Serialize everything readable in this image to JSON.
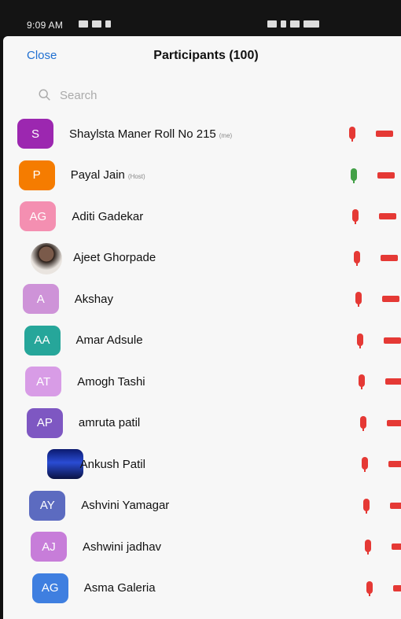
{
  "status_bar": {
    "time": "9:09 AM"
  },
  "header": {
    "close_label": "Close",
    "title": "Participants (100)"
  },
  "search": {
    "placeholder": "Search"
  },
  "colors": {
    "mic_muted": "#e53935",
    "mic_active": "#43a047",
    "video_off": "#e53935",
    "link": "#1f6fd1"
  },
  "participants": [
    {
      "initials": "S",
      "name": "Shaylsta Maner Roll No 215",
      "tag": "(me)",
      "avatar_color": "#9c27b0",
      "mic": "muted"
    },
    {
      "initials": "P",
      "name": "Payal Jain",
      "tag": "(Host)",
      "avatar_color": "#f57c00",
      "mic": "active"
    },
    {
      "initials": "AG",
      "name": "Aditi Gadekar",
      "tag": "",
      "avatar_color": "#f48fb1",
      "mic": "muted"
    },
    {
      "initials": "",
      "name": "Ajeet Ghorpade",
      "tag": "",
      "avatar_color": "photo",
      "mic": "muted"
    },
    {
      "initials": "A",
      "name": "Akshay",
      "tag": "",
      "avatar_color": "#ce93d8",
      "mic": "muted"
    },
    {
      "initials": "AA",
      "name": "Amar Adsule",
      "tag": "",
      "avatar_color": "#26a69a",
      "mic": "muted"
    },
    {
      "initials": "AT",
      "name": "Amogh Tashi",
      "tag": "",
      "avatar_color": "#d89ce6",
      "mic": "muted"
    },
    {
      "initials": "AP",
      "name": "amruta patil",
      "tag": "",
      "avatar_color": "#7e57c2",
      "mic": "muted"
    },
    {
      "initials": "",
      "name": "Ankush Patil",
      "tag": "",
      "avatar_color": "photo2",
      "mic": "muted"
    },
    {
      "initials": "AY",
      "name": "Ashvini Yamagar",
      "tag": "",
      "avatar_color": "#5c6bc0",
      "mic": "muted"
    },
    {
      "initials": "AJ",
      "name": "Ashwini jadhav",
      "tag": "",
      "avatar_color": "#c77dd9",
      "mic": "muted"
    },
    {
      "initials": "AG",
      "name": "Asma Galeria",
      "tag": "",
      "avatar_color": "#3f7fe0",
      "mic": "muted"
    }
  ]
}
